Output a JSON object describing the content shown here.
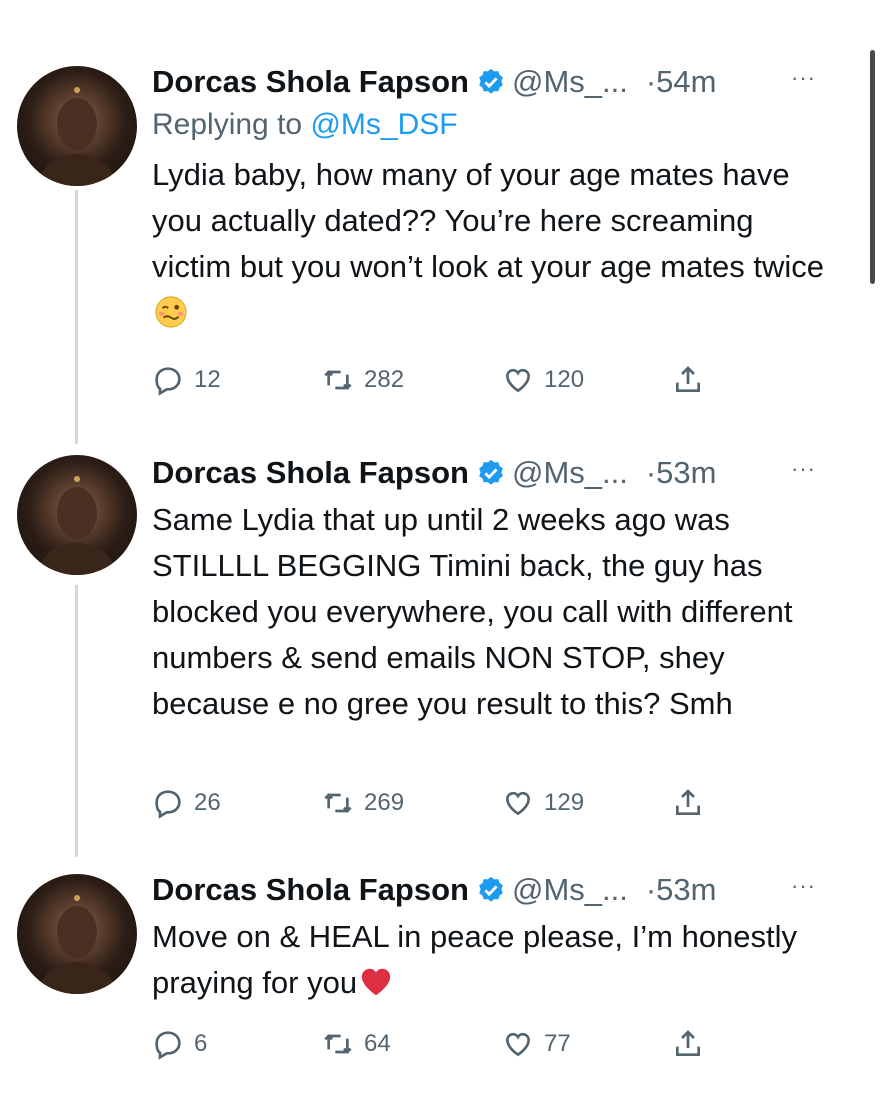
{
  "tweets": [
    {
      "name": "Dorcas Shola Fapson",
      "handle": "@Ms_...",
      "time": "54m",
      "more": "···",
      "reply_prefix": "Replying to ",
      "reply_handle": "@Ms_DSF",
      "text": "Lydia baby, how many of your age mates have you actually dated?? You’re here screaming victim but you won’t look at your age mates twice",
      "emoji": "woozy-face-icon",
      "replies": "12",
      "retweets": "282",
      "likes": "120"
    },
    {
      "name": "Dorcas Shola Fapson",
      "handle": "@Ms_...",
      "time": "53m",
      "more": "···",
      "text": "Same Lydia that up until 2 weeks ago was STILLLL BEGGING Timini back, the guy has blocked you everywhere, you call with different numbers & send emails NON STOP, shey because e no gree you result to this? Smh",
      "replies": "26",
      "retweets": "269",
      "likes": "129"
    },
    {
      "name": "Dorcas Shola Fapson",
      "handle": "@Ms_...",
      "time": "53m",
      "more": "···",
      "text": "Move on & HEAL in peace please, I’m honestly praying for you",
      "emoji": "red-heart-icon",
      "replies": "6",
      "retweets": "64",
      "likes": "77"
    }
  ],
  "colors": {
    "accent": "#1d9bf0",
    "muted": "#536471",
    "text": "#0f1419",
    "thread": "#cfd9de"
  }
}
